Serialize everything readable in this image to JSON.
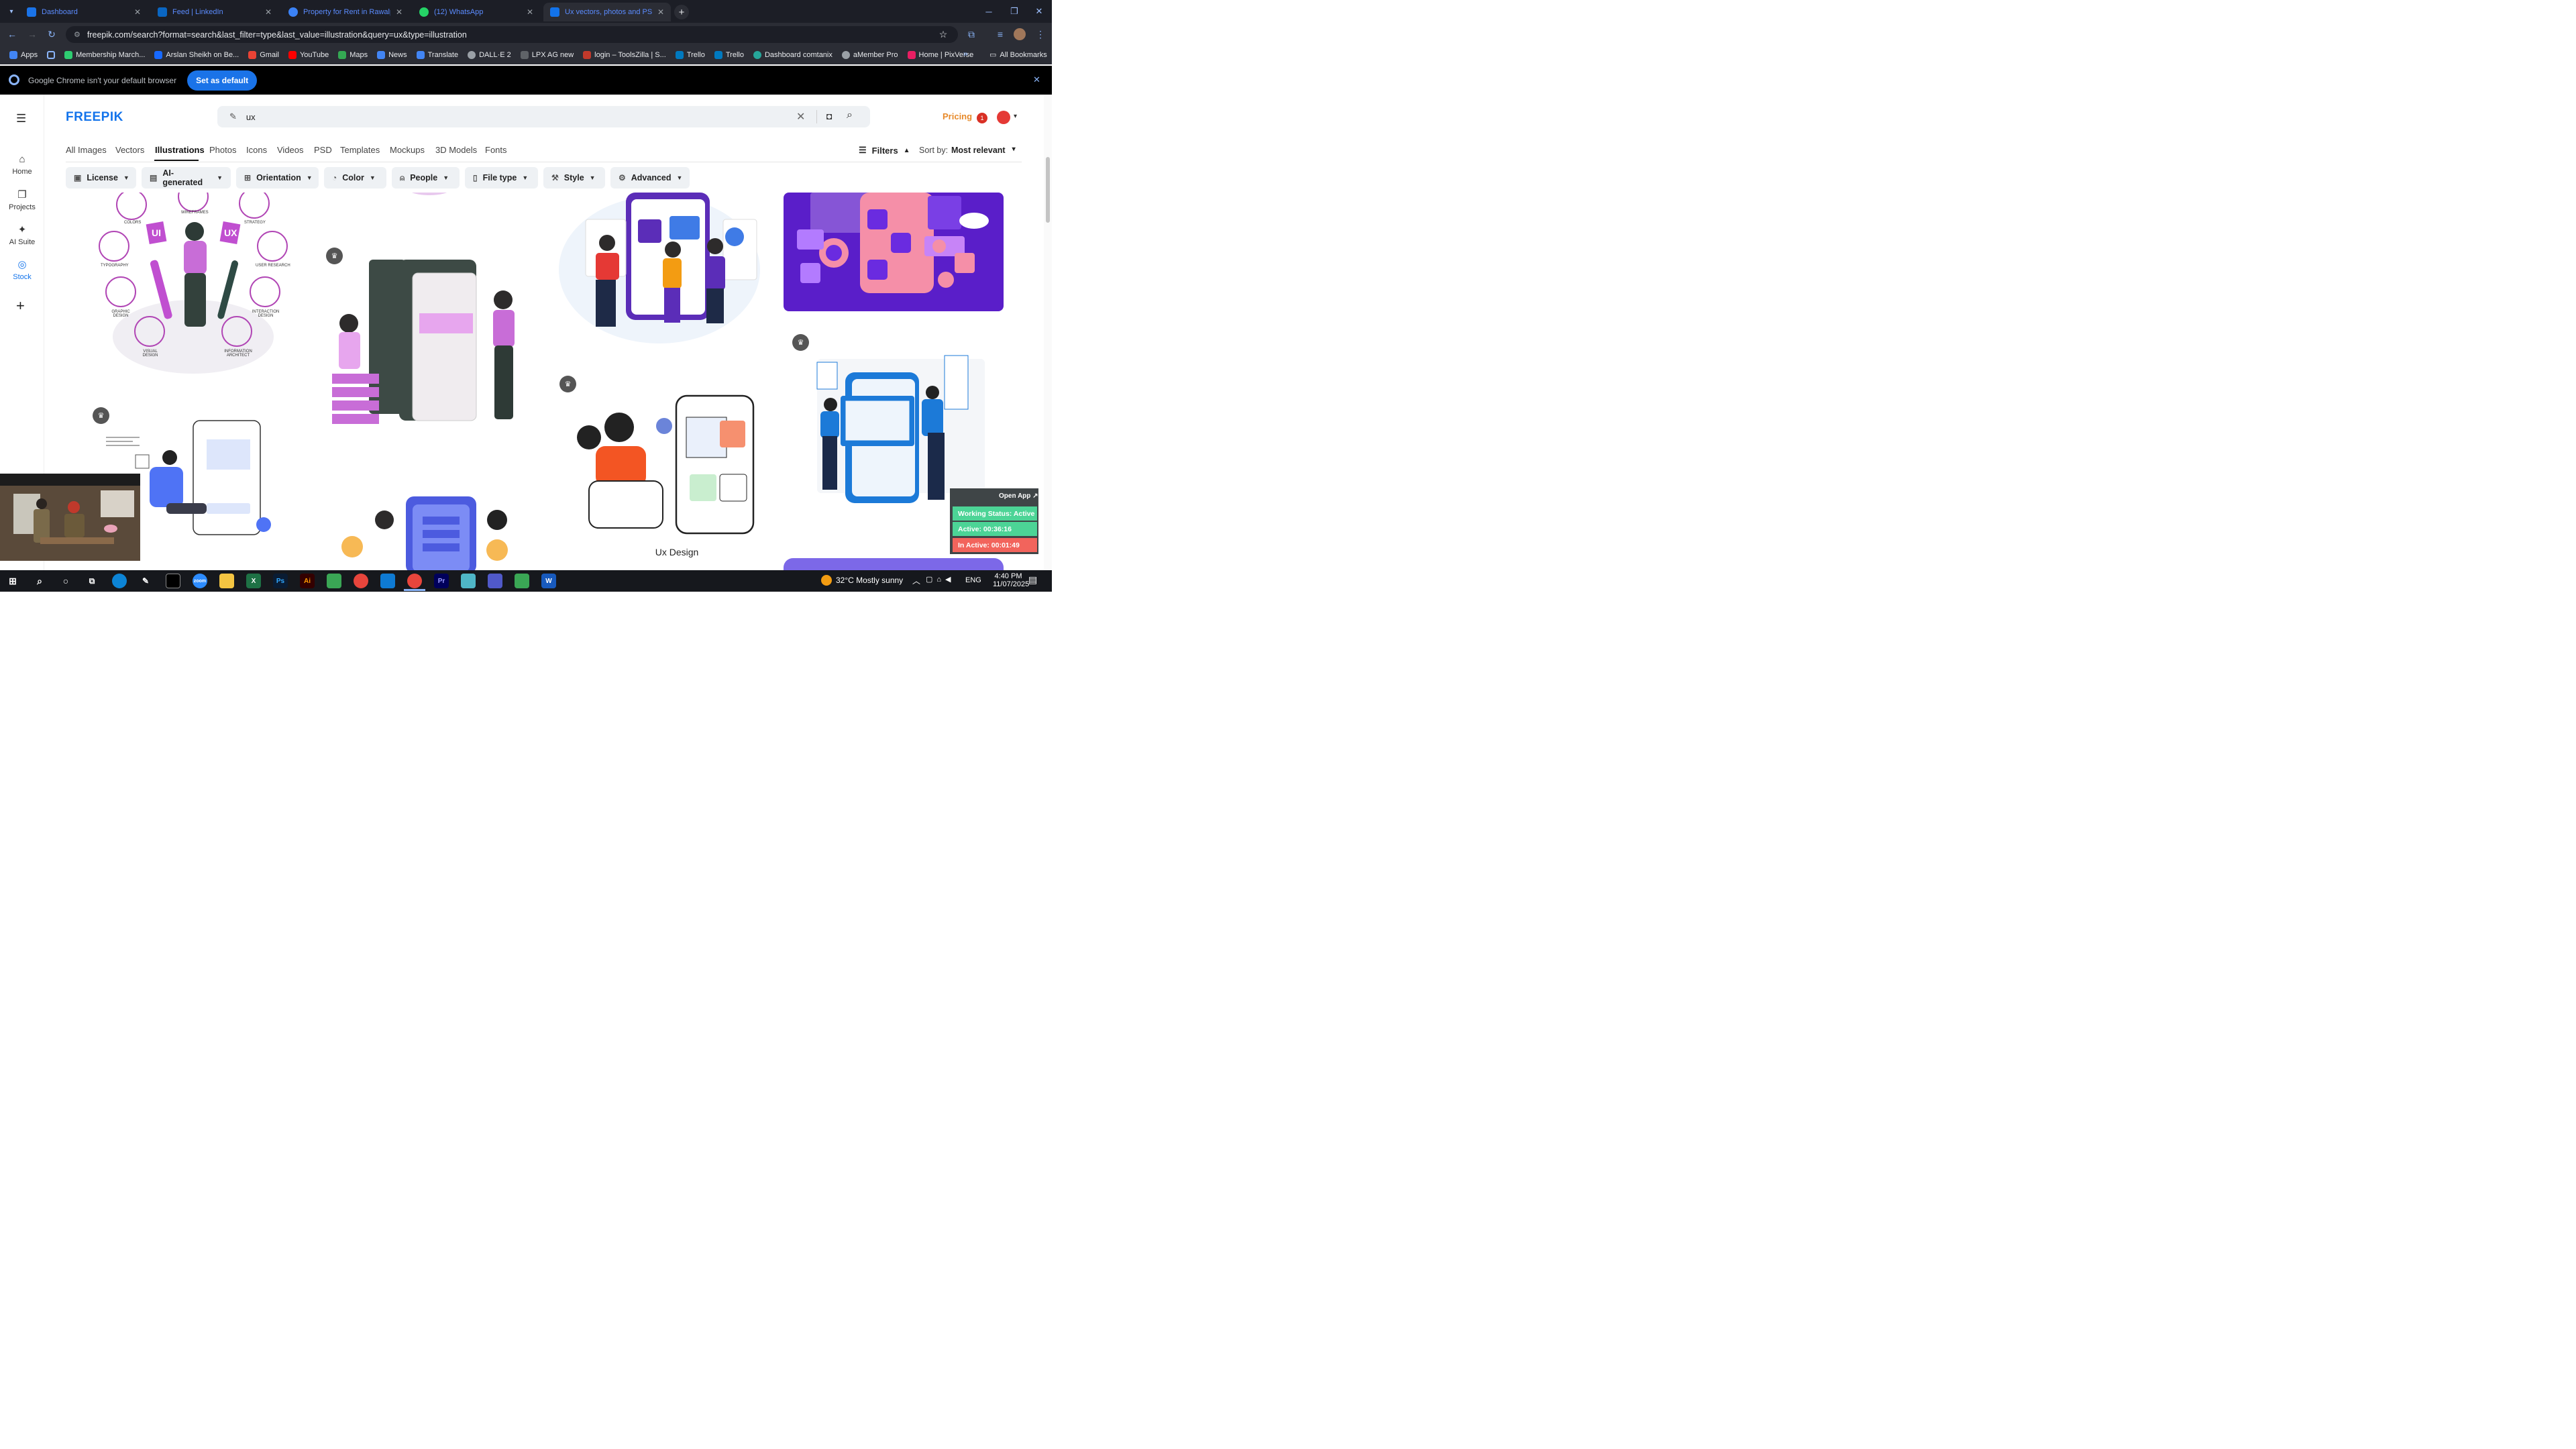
{
  "browser": {
    "tabs": [
      {
        "title": "Dashboard",
        "favicon_color": "#1a73e8"
      },
      {
        "title": "Feed | LinkedIn",
        "favicon_color": "#0a66c2"
      },
      {
        "title": "Property for Rent in Rawalpindi",
        "favicon_color": "#3b82f6"
      },
      {
        "title": "(12) WhatsApp",
        "favicon_color": "#25d366"
      },
      {
        "title": "Ux vectors, photos and PSD files",
        "favicon_color": "#1273eb"
      }
    ],
    "url": "freepik.com/search?format=search&last_filter=type&last_value=illustration&query=ux&type=illustration",
    "bookmarks": [
      {
        "label": "Apps",
        "color": "#4285f4"
      },
      {
        "label": "Membership March...",
        "color": "#2ecc71"
      },
      {
        "label": "Arslan Sheikh on Be...",
        "color": "#1769ff"
      },
      {
        "label": "Gmail",
        "color": "#ea4335"
      },
      {
        "label": "YouTube",
        "color": "#ff0000"
      },
      {
        "label": "Maps",
        "color": "#34a853"
      },
      {
        "label": "News",
        "color": "#4285f4"
      },
      {
        "label": "Translate",
        "color": "#4285f4"
      },
      {
        "label": "DALL·E 2",
        "color": "#9aa0a6"
      },
      {
        "label": "LPX AG new",
        "color": "#5f6368"
      },
      {
        "label": "login – ToolsZilla | S...",
        "color": "#c0392b"
      },
      {
        "label": "Trello",
        "color": "#0079bf"
      },
      {
        "label": "Trello",
        "color": "#0079bf"
      },
      {
        "label": "Dashboard comtanix",
        "color": "#26a69a"
      },
      {
        "label": "aMember Pro",
        "color": "#9aa0a6"
      },
      {
        "label": "Home | PixVerse",
        "color": "#e91e63"
      }
    ],
    "all_bookmarks": "All Bookmarks",
    "banner_text": "Google Chrome isn't your default browser",
    "banner_button": "Set as default"
  },
  "sidebar": {
    "items": [
      {
        "label": "Home"
      },
      {
        "label": "Projects"
      },
      {
        "label": "AI Suite"
      },
      {
        "label": "Stock"
      }
    ]
  },
  "header": {
    "logo": "FREEPIK",
    "search_value": "ux",
    "pricing": "Pricing",
    "notification_count": "1"
  },
  "type_tabs": [
    "All Images",
    "Vectors",
    "Illustrations",
    "Photos",
    "Icons",
    "Videos",
    "PSD",
    "Templates",
    "Mockups",
    "3D Models",
    "Fonts"
  ],
  "filters_label": "Filters",
  "sort_by_label": "Sort by:",
  "sort_value": "Most relevant",
  "filter_chips": [
    "License",
    "AI-generated",
    "Orientation",
    "Color",
    "People",
    "File type",
    "Style",
    "Advanced"
  ],
  "illustration_labels": {
    "colors": "COLORS",
    "wireframes": "WIREFRAMES",
    "strategy": "STRATEGY",
    "typography": "TYPOGRAPHY",
    "user_research": "USER RESEARCH",
    "graphic_design": "GRAPHIC DESIGN",
    "interaction_design": "INTERACTION DESIGN",
    "visual_design": "VISUAL DESIGN",
    "information_architect": "INFORMATION ARCHITECT",
    "ui": "UI",
    "ux": "UX",
    "ux_design_caption": "Ux Design"
  },
  "tracker": {
    "open_app": "Open App ↗",
    "working_status": "Working Status: Active",
    "active": "Active: 00:36:16",
    "inactive": "In Active: 00:01:49"
  },
  "taskbar": {
    "weather": "32°C  Mostly sunny",
    "lang": "ENG",
    "time": "4:40 PM",
    "date": "11/07/2025"
  }
}
